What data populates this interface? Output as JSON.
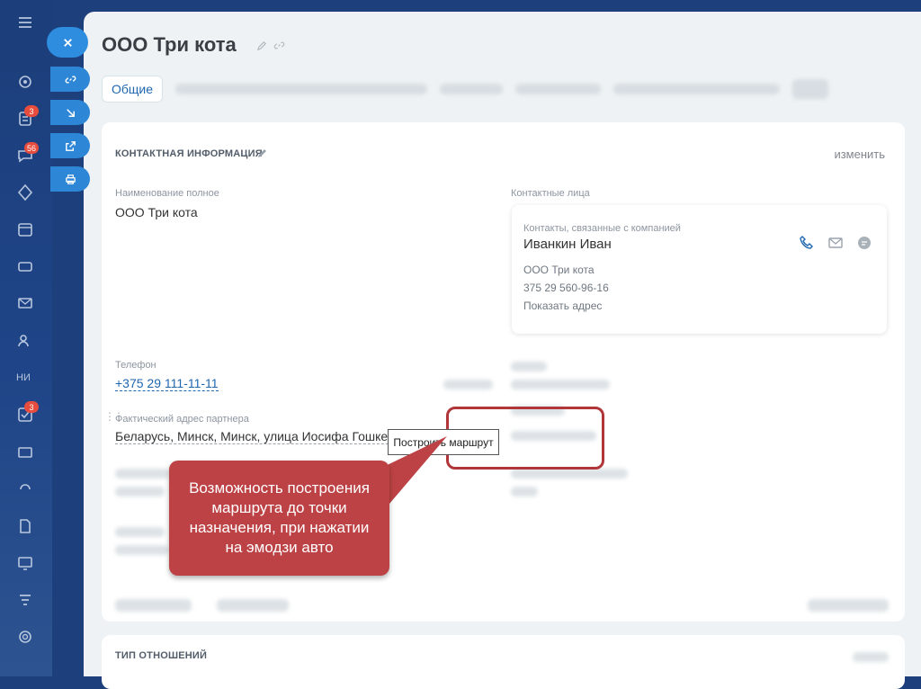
{
  "page": {
    "title": "ООО Три кота"
  },
  "tabs": {
    "active": "Общие"
  },
  "sidebar": {
    "badges": {
      "tasks": "3",
      "chat": "56",
      "feed": "3"
    },
    "initials": "НИ"
  },
  "contact_section": {
    "title": "КОНТАКТНАЯ ИНФОРМАЦИЯ",
    "edit_label": "изменить",
    "full_name_label": "Наименование полное",
    "full_name_value": "ООО Три кота",
    "phone_label": "Телефон",
    "phone_value": "+375 29 111-11-11",
    "address_label": "Фактический адрес партнера",
    "address_value": "Беларусь, Минск, Минск, улица Иосифа Гошкевича",
    "contacts_label": "Контактные лица"
  },
  "contact_card": {
    "header": "Контакты, связанные с компанией",
    "name": "Иванкин Иван",
    "company": "ООО Три кота",
    "phone": "375 29 560-96-16",
    "show_address": "Показать адрес"
  },
  "tooltip": {
    "text": "Построить маршрут"
  },
  "callout": {
    "text": "Возможность построения маршрута до точки назначения, при нажатии на эмодзи авто",
    "color": "#bd4245"
  },
  "relation_section": {
    "title": "ТИП ОТНОШЕНИЙ"
  },
  "colors": {
    "accent": "#2067b0",
    "sidebar": "#1c3e7a",
    "fab": "#2d86d6"
  }
}
